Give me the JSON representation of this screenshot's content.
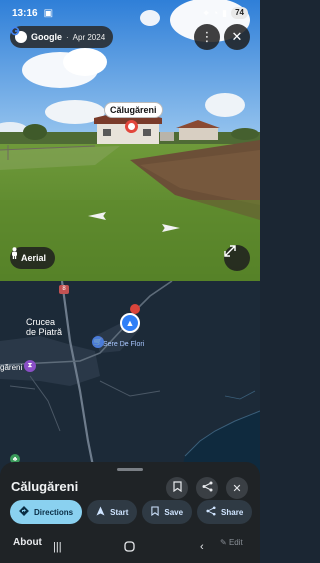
{
  "status_bar": {
    "time": "13:16",
    "battery": "74"
  },
  "street_view": {
    "provider": "Google",
    "date": "Apr 2024",
    "place_label": "Călugăreni",
    "aerial_label": "Aerial"
  },
  "map": {
    "labels": {
      "village": "Crucea\nde Piatră",
      "poi_store": "Sere De Flori",
      "left_edge": "găreni"
    },
    "road_badge": "8"
  },
  "sheet": {
    "title": "Călugăreni",
    "actions": [
      {
        "label": "Directions",
        "icon": "directions-icon"
      },
      {
        "label": "Start",
        "icon": "navigation-arrow-icon"
      },
      {
        "label": "Save",
        "icon": "bookmark-icon"
      },
      {
        "label": "Share",
        "icon": "share-icon"
      }
    ],
    "about_tab": "About",
    "edit_label": "Edit"
  },
  "colors": {
    "accent": "#8ad1f0",
    "pin_red": "#e2473c",
    "location_blue": "#2f7ff7",
    "sheet_bg": "#1f2326"
  }
}
